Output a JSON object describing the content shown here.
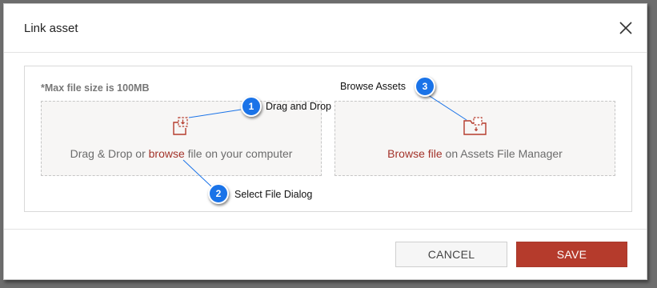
{
  "dialog": {
    "title": "Link asset",
    "max_size_note": "*Max file size is 100MB",
    "left_zone": {
      "prefix": "Drag & Drop or ",
      "link": "browse",
      "suffix": " file on your computer"
    },
    "right_zone": {
      "link": "Browse file",
      "suffix": " on Assets File Manager"
    },
    "cancel_label": "CANCEL",
    "save_label": "SAVE"
  },
  "callouts": [
    {
      "number": "1",
      "label": "Drag and Drop"
    },
    {
      "number": "2",
      "label": "Select File Dialog"
    },
    {
      "number": "3",
      "label": "Browse Assets"
    }
  ],
  "colors": {
    "accent": "#b53b2c",
    "link": "#a3332a",
    "callout": "#1a73e8"
  },
  "icons": [
    "close-icon",
    "upload-file-icon",
    "folder-icon"
  ]
}
